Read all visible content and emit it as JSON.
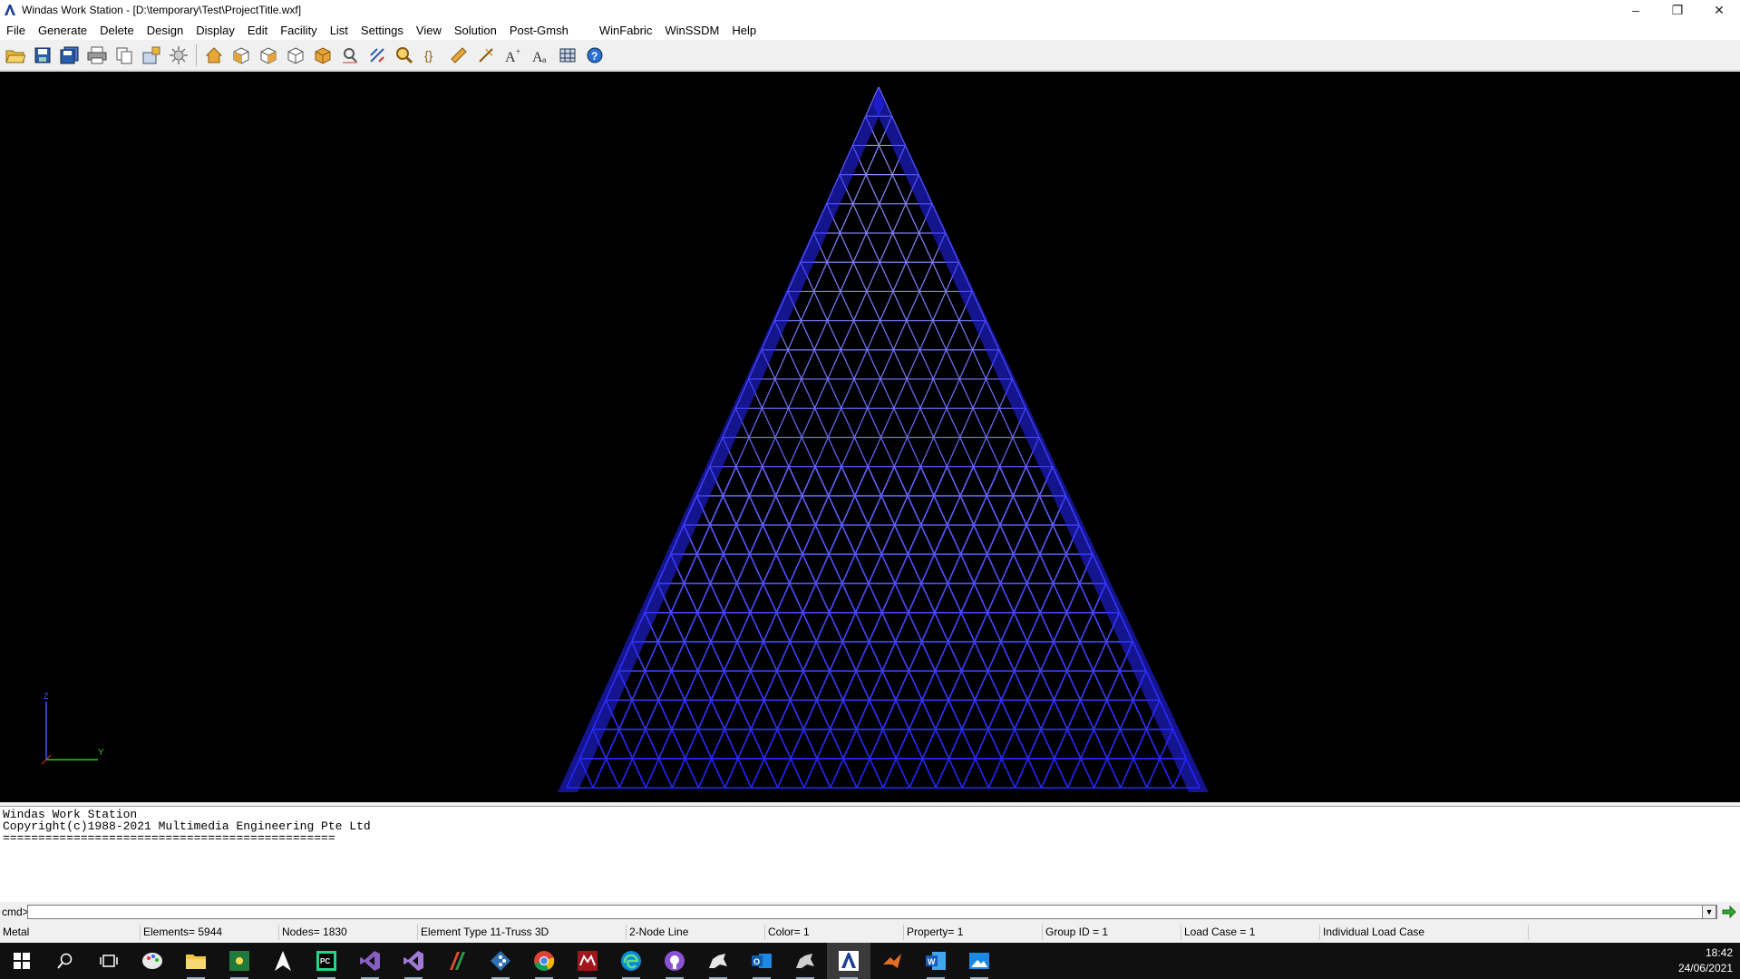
{
  "window": {
    "title": "Windas Work Station - [D:\\temporary\\Test\\ProjectTitle.wxf]",
    "controls": {
      "minimize": "–",
      "restore": "❐",
      "close": "✕"
    }
  },
  "menu": [
    "File",
    "Generate",
    "Delete",
    "Design",
    "Display",
    "Edit",
    "Facility",
    "List",
    "Settings",
    "View",
    "Solution",
    "Post-Gmsh",
    "WinFabric",
    "WinSSDM",
    "Help"
  ],
  "toolbar": [
    "open-folder-icon",
    "save-icon",
    "save-all-icon",
    "print-icon",
    "copy-icon",
    "export-icon",
    "light-icon",
    "home-view-icon",
    "cube-front-icon",
    "cube-side-icon",
    "cube-top-icon",
    "cube-iso-icon",
    "zoom-window-icon",
    "zoom-extents-icon",
    "zoom-icon",
    "rotate-icon",
    "pan-icon",
    "measure-icon",
    "text-size-icon",
    "text-style-icon",
    "grid-icon",
    "help-icon"
  ],
  "viewport": {
    "background": "#000000",
    "model_color_top": "#8f8fff",
    "model_color_bottom": "#2424ff",
    "axis": {
      "z_label": "Z",
      "y_label": "Y"
    }
  },
  "console": {
    "lines": [
      "Windas Work Station",
      "Copyright(c)1988-2021 Multimedia Engineering Pte Ltd",
      "==============================================="
    ]
  },
  "cmd": {
    "label": "cmd>",
    "value": ""
  },
  "status": {
    "material": "Metal",
    "elements": "Elements=  5944",
    "nodes": "Nodes=  1830",
    "element_type": "Element Type 11-Truss 3D",
    "line_type": "2-Node Line",
    "color": "Color= 1",
    "property": "Property= 1",
    "group": "Group ID =     1",
    "load_case": "Load Case =   1",
    "load_mode": "Individual Load Case"
  },
  "taskbar": {
    "apps": [
      "start-icon",
      "search-icon",
      "task-view-icon",
      "paint-icon",
      "file-explorer-icon",
      "mindmap-icon",
      "sketch-icon",
      "pycharm-icon",
      "visual-studio-icon",
      "visual-studio-alt-icon",
      "rstudio-icon",
      "git-icon",
      "chrome-icon",
      "mendeley-icon",
      "edge-icon",
      "github-icon",
      "rhino-icon",
      "outlook-icon",
      "rhino-alt-icon",
      "windas-icon",
      "matlab-icon",
      "word-icon",
      "photos-icon"
    ],
    "time": "18:42",
    "date": "24/06/2021"
  }
}
